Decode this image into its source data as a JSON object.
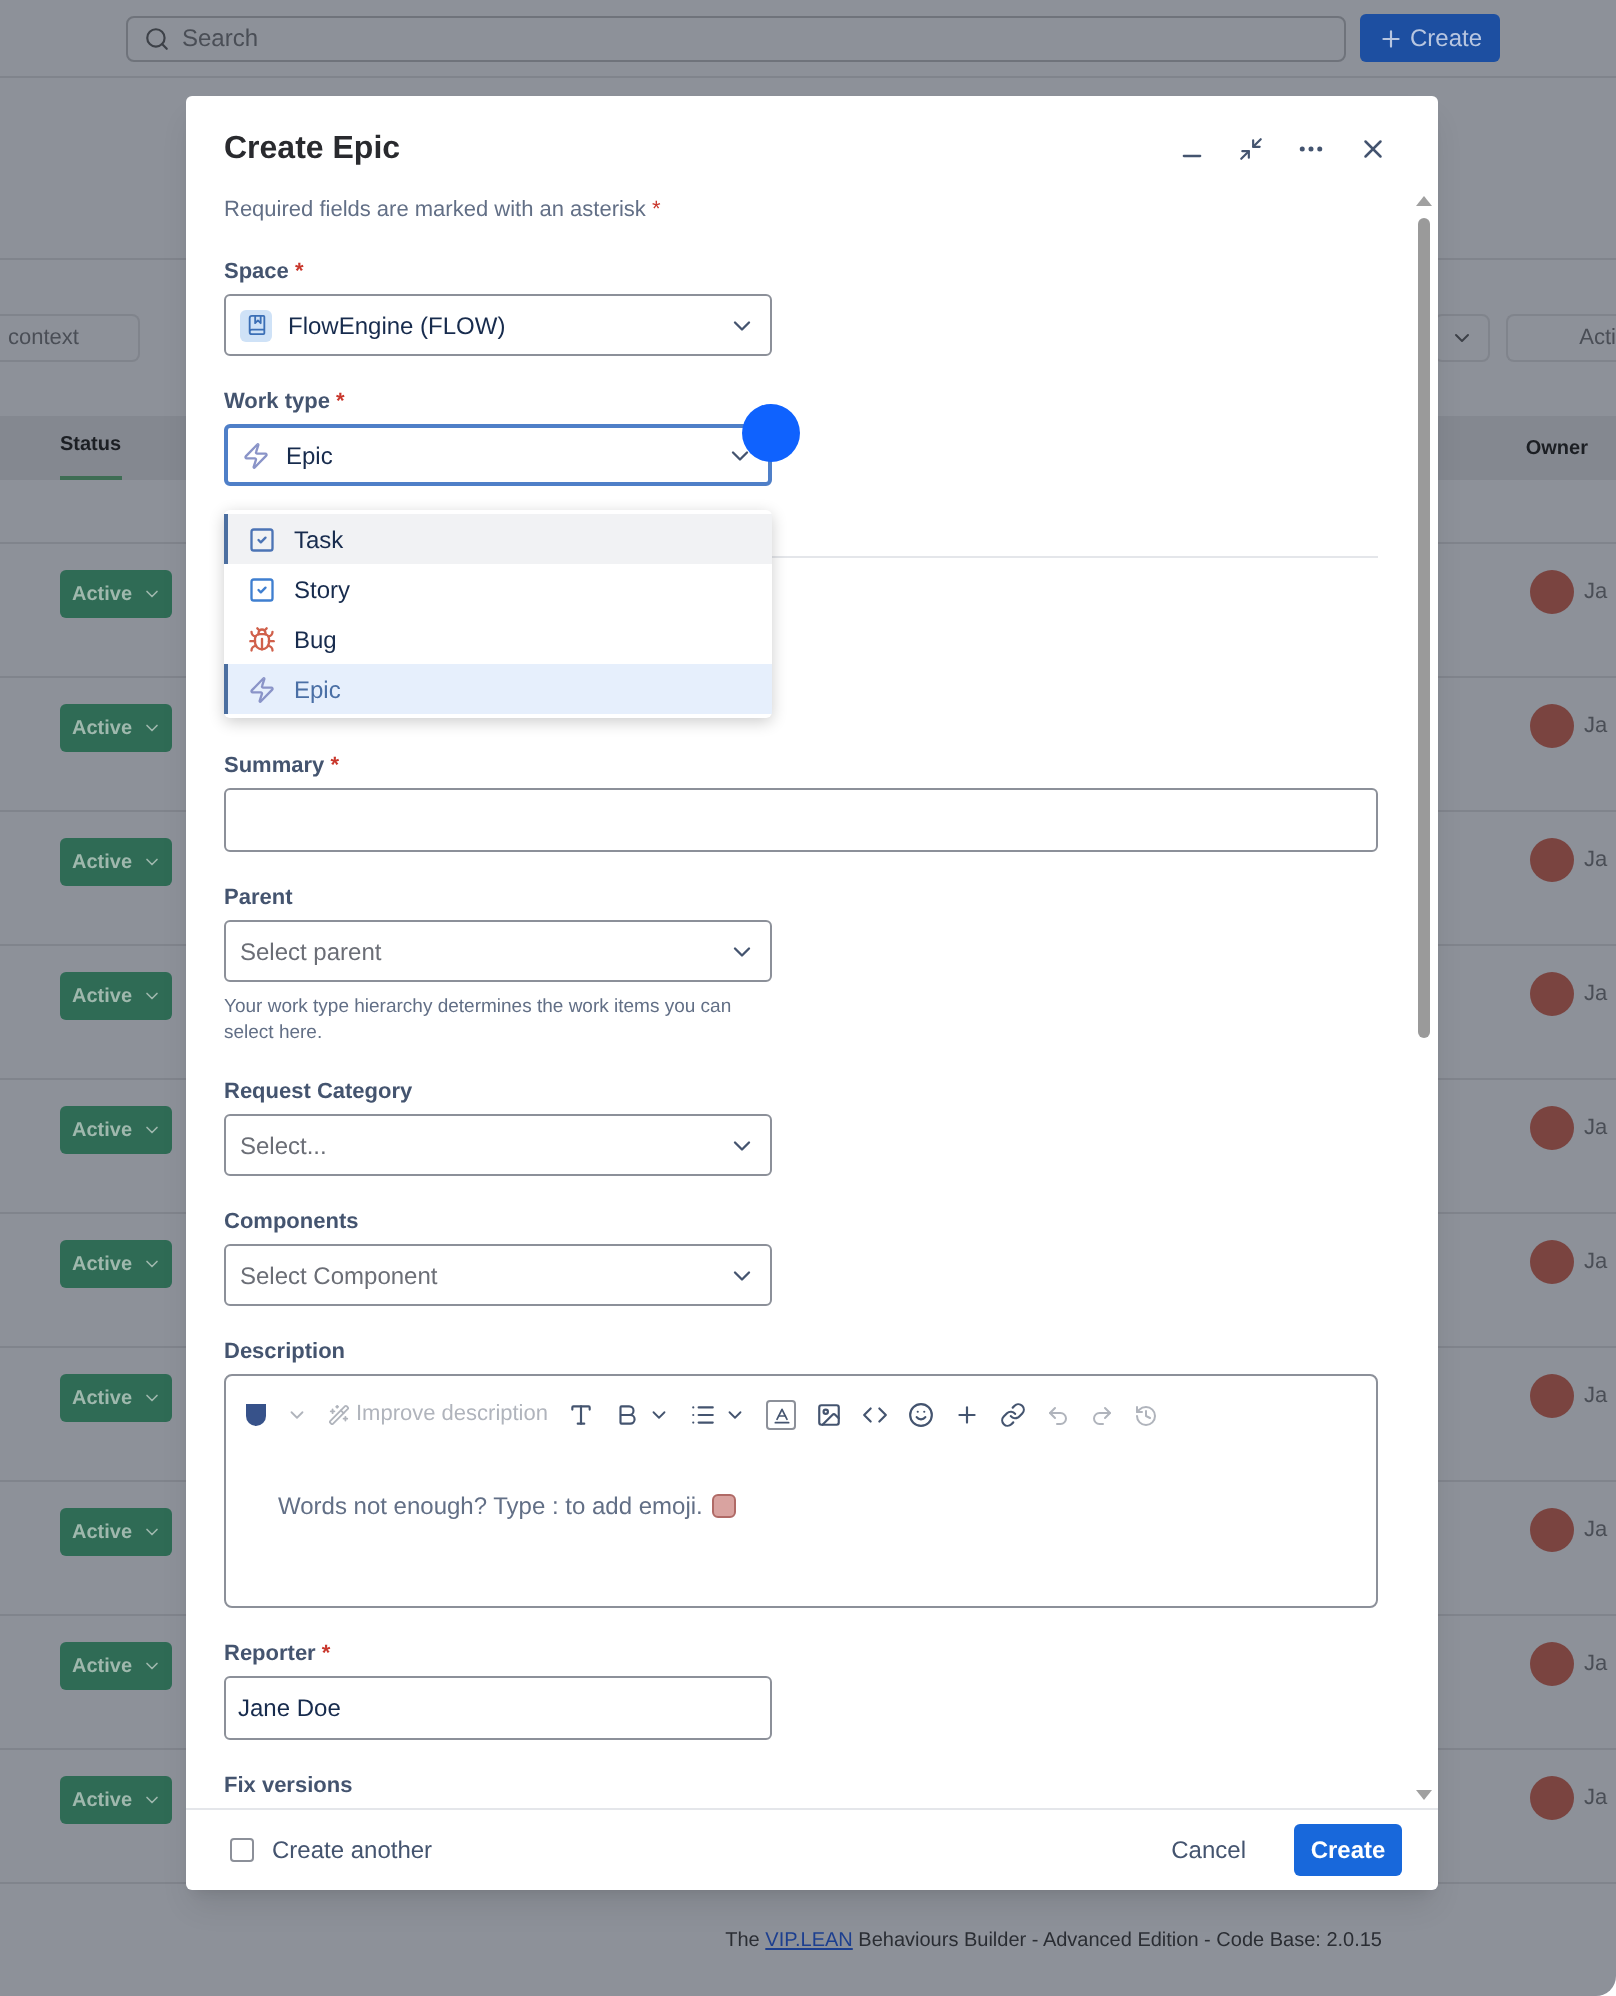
{
  "background": {
    "search": {
      "placeholder": "Search"
    },
    "create_button": "Create",
    "filters": [
      "context",
      "Acti"
    ],
    "table": {
      "columns": [
        "Status",
        "Owner"
      ],
      "rows": [
        {
          "status": "Active",
          "owner": "Ja"
        },
        {
          "status": "Active",
          "owner": "Ja"
        },
        {
          "status": "Active",
          "owner": "Ja"
        },
        {
          "status": "Active",
          "owner": "Ja"
        },
        {
          "status": "Active",
          "owner": "Ja"
        },
        {
          "status": "Active",
          "owner": "Ja"
        },
        {
          "status": "Active",
          "owner": "Ja"
        },
        {
          "status": "Active",
          "owner": "Ja"
        },
        {
          "status": "Active",
          "owner": "Ja"
        },
        {
          "status": "Active",
          "owner": "Ja"
        }
      ]
    },
    "footer": {
      "before": "The",
      "link": "VIP.LEAN",
      "after": "Behaviours Builder - Advanced Edition - Code Base: 2.0.15"
    }
  },
  "dialog": {
    "title": "Create Epic",
    "required_note": "Required fields are marked with an asterisk",
    "required_mark": "*",
    "fields": [
      {
        "kind": "select",
        "label": "Space",
        "required": true,
        "value": "FlowEngine (FLOW)"
      },
      {
        "kind": "select",
        "label": "Work type",
        "required": true,
        "value": "Epic",
        "focused": true,
        "options": [
          {
            "label": "Task",
            "kind": "task",
            "highlighted": true,
            "selected": false
          },
          {
            "label": "Story",
            "kind": "story",
            "highlighted": false,
            "selected": false
          },
          {
            "label": "Bug",
            "kind": "bug",
            "highlighted": false,
            "selected": false
          },
          {
            "label": "Epic",
            "kind": "epic",
            "highlighted": false,
            "selected": true
          }
        ]
      },
      {
        "kind": "divider"
      },
      {
        "kind": "text",
        "label": "Summary",
        "required": true,
        "wide": true
      },
      {
        "kind": "select",
        "label": "Parent",
        "required": false,
        "placeholder": "Select parent",
        "helper": "Your work type hierarchy determines the work items you can select here."
      },
      {
        "kind": "select",
        "label": "Request Category",
        "required": false,
        "placeholder": "Select..."
      },
      {
        "kind": "select",
        "label": "Components",
        "required": false,
        "placeholder": "Select Component"
      },
      {
        "kind": "editor",
        "label": "Description",
        "required": false,
        "improve": "Improve description",
        "placeholder": "Words not enough? Type : to add emoji."
      },
      {
        "kind": "text",
        "label": "Reporter",
        "required": true,
        "value": "Jane Doe"
      },
      {
        "kind": "label",
        "label": "Fix versions",
        "required": false
      }
    ],
    "create_another": {
      "label": "Create another",
      "checked": false
    },
    "cancel": "Cancel",
    "submit": "Create"
  }
}
